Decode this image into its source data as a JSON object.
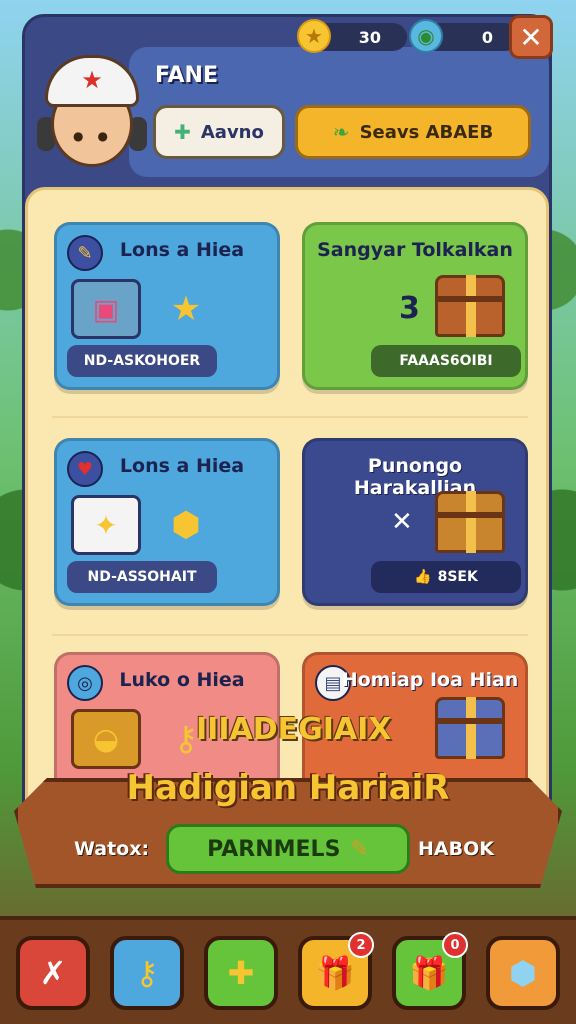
{
  "header": {
    "player_name": "FANE",
    "gold_amount": "30",
    "gem_amount": "0",
    "save_label": "Aavno",
    "search_label": "Seavs ABAEB"
  },
  "cards": [
    {
      "title": "Lons a Hiea",
      "footer": "ND-ASKOHOER",
      "color": "#4ea7dd"
    },
    {
      "title": "Sangyar Tolkalkan",
      "center": "3",
      "footer": "FAAAS6OIBI",
      "color": "#7bc74a"
    },
    {
      "title": "Lons a Hiea",
      "footer": "ND-ASSOHAIT",
      "color": "#4ea7dd"
    },
    {
      "title": "Punongo Harakallian",
      "center": "✕",
      "footer": "8SEK",
      "color": "#3b4a8e"
    },
    {
      "title": "Luko o Hiea",
      "color": "#f08b86"
    },
    {
      "title": "Homiap Ioa Hian",
      "color": "#e06a3a"
    }
  ],
  "banner": {
    "word": "IIIADEGIAIX",
    "title": "Hadigian HariaiR",
    "left_text": "Watox:",
    "cta_label": "PARNMELS",
    "right_text": "HABOK"
  },
  "nav": {
    "badge_a": "2",
    "badge_b": "0"
  },
  "icons": [
    "star-icon",
    "globe-icon",
    "close-icon",
    "puzzle-icon",
    "leaf-icon",
    "heart-icon",
    "chest-icon",
    "crown-icon"
  ],
  "colors": {
    "panel": "#3b4a86",
    "content": "#fbe7b0",
    "accent_gold": "#f7c531",
    "cta_green": "#66c43a"
  }
}
